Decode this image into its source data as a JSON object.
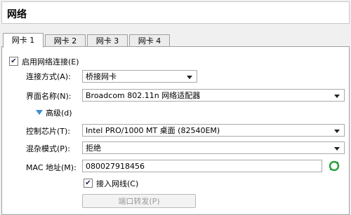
{
  "header": {
    "title": "网络"
  },
  "tabs": [
    {
      "label": "网卡 1"
    },
    {
      "label": "网卡 2"
    },
    {
      "label": "网卡 3"
    },
    {
      "label": "网卡 4"
    }
  ],
  "adapter": {
    "enable_label": "启用网络连接(E)",
    "attached_to_label": "连接方式(A):",
    "attached_to_value": "桥接网卡",
    "name_label": "界面名称(N):",
    "name_value": "Broadcom 802.11n 网络适配器",
    "advanced_label": "高级(d)",
    "adapter_type_label": "控制芯片(T):",
    "adapter_type_value": "Intel PRO/1000 MT 桌面 (82540EM)",
    "promiscuous_label": "混杂模式(P):",
    "promiscuous_value": "拒绝",
    "mac_label": "MAC 地址(M):",
    "mac_value": "080027918456",
    "cable_label": "接入网线(C)",
    "port_forwarding_label": "端口转发(P)"
  },
  "colors": {
    "accent_arrow": "#3a8fd5",
    "refresh_icon": "#2ea043"
  }
}
